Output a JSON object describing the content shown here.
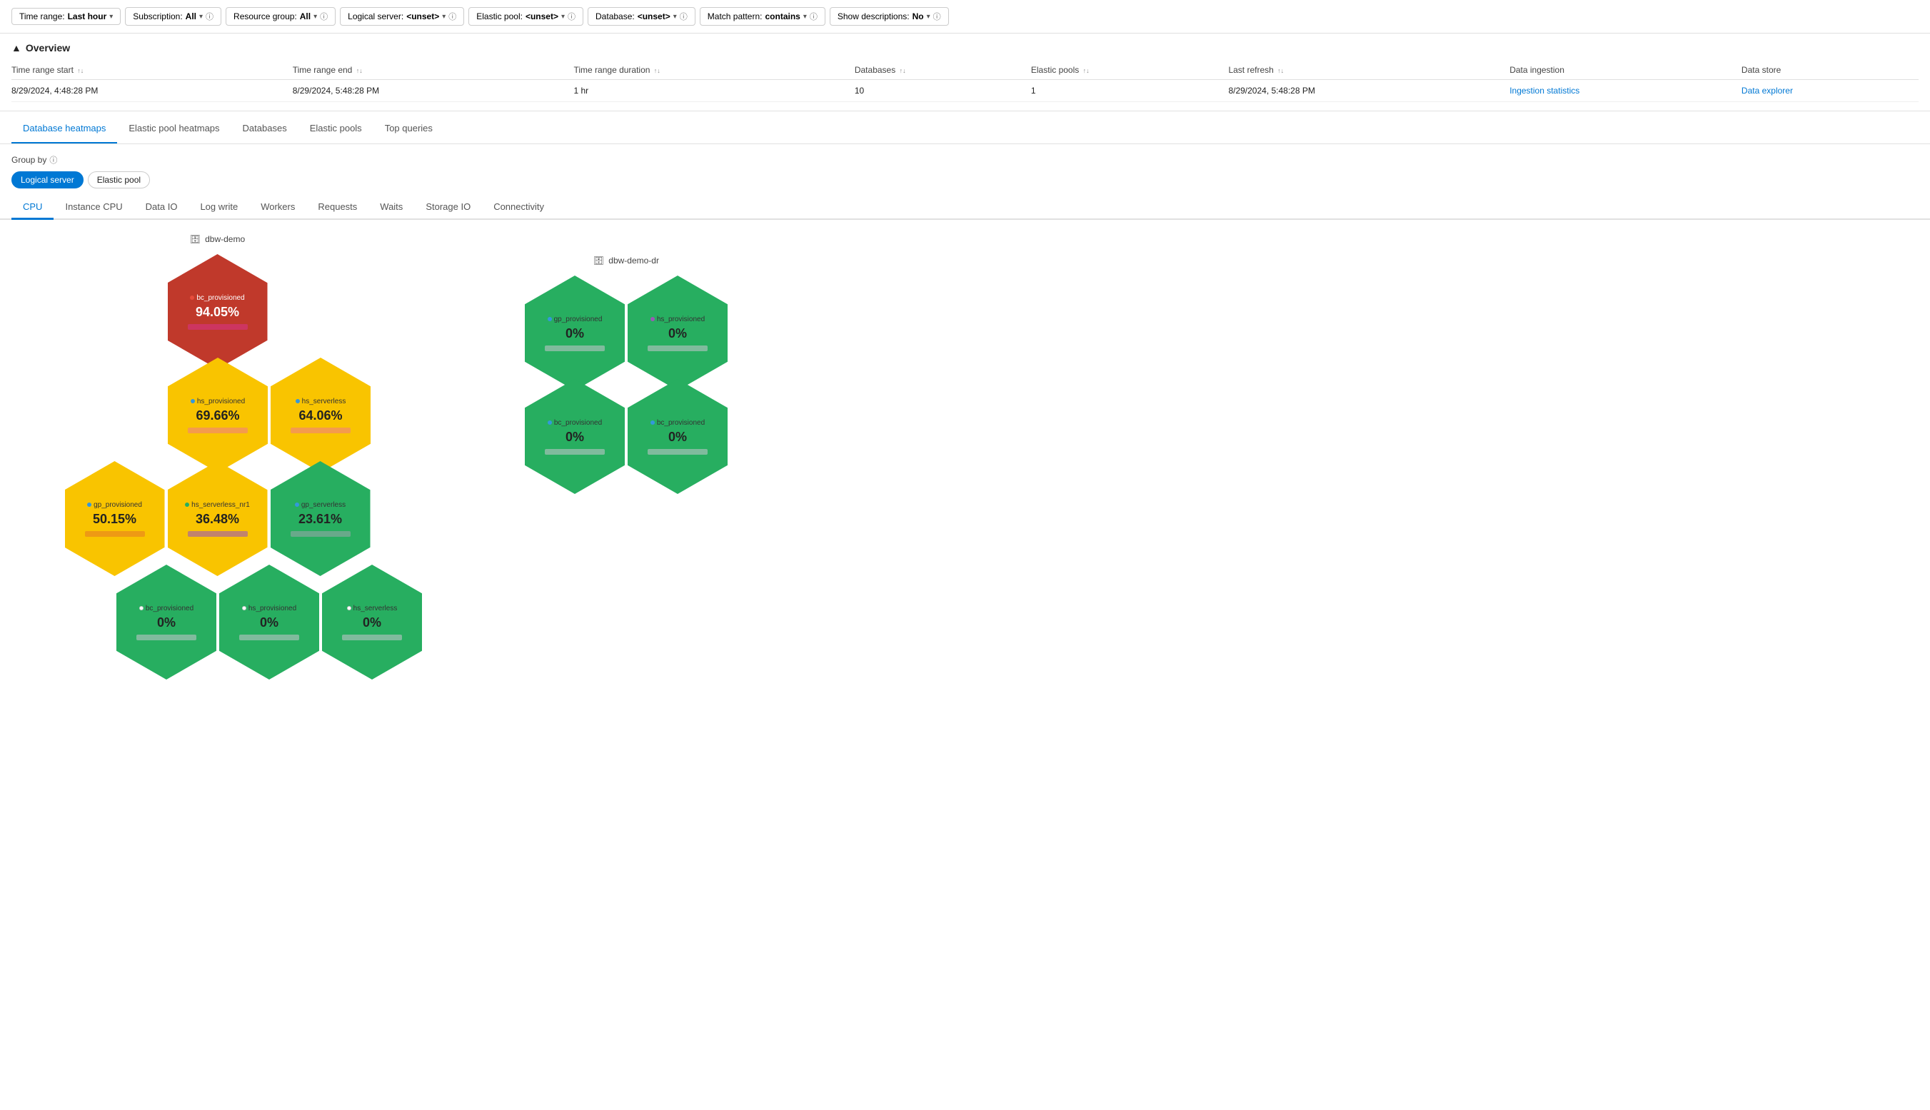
{
  "filterBar": {
    "timeRange": {
      "label": "Time range:",
      "value": "Last hour"
    },
    "subscription": {
      "label": "Subscription:",
      "value": "All"
    },
    "resourceGroup": {
      "label": "Resource group:",
      "value": "All"
    },
    "logicalServer": {
      "label": "Logical server:",
      "value": "<unset>"
    },
    "elasticPool": {
      "label": "Elastic pool:",
      "value": "<unset>"
    },
    "database": {
      "label": "Database:",
      "value": "<unset>"
    },
    "matchPattern": {
      "label": "Match pattern:",
      "value": "contains"
    },
    "showDescriptions": {
      "label": "Show descriptions:",
      "value": "No"
    }
  },
  "overview": {
    "title": "Overview",
    "table": {
      "columns": [
        {
          "id": "timeStart",
          "label": "Time range start",
          "sortable": true
        },
        {
          "id": "timeEnd",
          "label": "Time range end",
          "sortable": true
        },
        {
          "id": "duration",
          "label": "Time range duration",
          "sortable": true
        },
        {
          "id": "databases",
          "label": "Databases",
          "sortable": true
        },
        {
          "id": "elasticPools",
          "label": "Elastic pools",
          "sortable": true
        },
        {
          "id": "lastRefresh",
          "label": "Last refresh",
          "sortable": true
        },
        {
          "id": "dataIngestion",
          "label": "Data ingestion",
          "sortable": false
        },
        {
          "id": "dataStore",
          "label": "Data store",
          "sortable": false
        }
      ],
      "row": {
        "timeStart": "8/29/2024, 4:48:28 PM",
        "timeEnd": "8/29/2024, 5:48:28 PM",
        "duration": "1 hr",
        "databases": "10",
        "elasticPools": "1",
        "lastRefresh": "8/29/2024, 5:48:28 PM",
        "dataIngestion": "Ingestion statistics",
        "dataStore": "Data explorer"
      }
    }
  },
  "mainTabs": [
    {
      "id": "database-heatmaps",
      "label": "Database heatmaps",
      "active": true
    },
    {
      "id": "elastic-pool-heatmaps",
      "label": "Elastic pool heatmaps",
      "active": false
    },
    {
      "id": "databases",
      "label": "Databases",
      "active": false
    },
    {
      "id": "elastic-pools",
      "label": "Elastic pools",
      "active": false
    },
    {
      "id": "top-queries",
      "label": "Top queries",
      "active": false
    }
  ],
  "groupBy": {
    "label": "Group by",
    "options": [
      {
        "id": "logical-server",
        "label": "Logical server",
        "active": true
      },
      {
        "id": "elastic-pool",
        "label": "Elastic pool",
        "active": false
      }
    ]
  },
  "metricTabs": [
    {
      "id": "cpu",
      "label": "CPU",
      "active": true
    },
    {
      "id": "instance-cpu",
      "label": "Instance CPU",
      "active": false
    },
    {
      "id": "data-io",
      "label": "Data IO",
      "active": false
    },
    {
      "id": "log-write",
      "label": "Log write",
      "active": false
    },
    {
      "id": "workers",
      "label": "Workers",
      "active": false
    },
    {
      "id": "requests",
      "label": "Requests",
      "active": false
    },
    {
      "id": "waits",
      "label": "Waits",
      "active": false
    },
    {
      "id": "storage-io",
      "label": "Storage IO",
      "active": false
    },
    {
      "id": "connectivity",
      "label": "Connectivity",
      "active": false
    }
  ],
  "clusters": [
    {
      "id": "dbw-demo",
      "label": "dbw-demo",
      "rows": [
        [
          {
            "name": "bc_provisioned",
            "value": "94.05%",
            "color": "red",
            "dotColor": "red",
            "barColor": "bar-pink"
          }
        ],
        [
          {
            "name": "hs_provisioned",
            "value": "69.66%",
            "color": "yellow",
            "dotColor": "blue",
            "barColor": "bar-salmon"
          },
          {
            "name": "hs_serverless",
            "value": "64.06%",
            "color": "yellow",
            "dotColor": "blue",
            "barColor": "bar-salmon"
          }
        ],
        [
          {
            "name": "gp_provisioned",
            "value": "50.15%",
            "color": "yellow",
            "dotColor": "blue",
            "barColor": "bar-orange"
          },
          {
            "name": "hs_serverless_nr1",
            "value": "36.48%",
            "color": "yellow",
            "dotColor": "green",
            "barColor": "bar-purple"
          },
          {
            "name": "gp_serverless",
            "value": "23.61%",
            "color": "dark-green",
            "dotColor": "blue",
            "barColor": "bar-gray"
          }
        ],
        [
          {
            "name": "bc_provisioned",
            "value": "0%",
            "color": "dark-green",
            "dotColor": "white",
            "barColor": "bar-light-gray"
          },
          {
            "name": "hs_provisioned",
            "value": "0%",
            "color": "dark-green",
            "dotColor": "white",
            "barColor": "bar-light-gray"
          },
          {
            "name": "hs_serverless",
            "value": "0%",
            "color": "dark-green",
            "dotColor": "white",
            "barColor": "bar-light-gray"
          }
        ]
      ]
    },
    {
      "id": "dbw-demo-dr",
      "label": "dbw-demo-dr",
      "rows": [
        [
          {
            "name": "gp_provisioned",
            "value": "0%",
            "color": "dark-green",
            "dotColor": "blue",
            "barColor": "bar-light-gray"
          },
          {
            "name": "hs_provisioned",
            "value": "0%",
            "color": "dark-green",
            "dotColor": "purple",
            "barColor": "bar-light-gray"
          }
        ],
        [
          {
            "name": "bc_provisioned",
            "value": "0%",
            "color": "dark-green",
            "dotColor": "blue",
            "barColor": "bar-light-gray"
          },
          {
            "name": "bc_provisioned",
            "value": "0%",
            "color": "dark-green",
            "dotColor": "blue",
            "barColor": "bar-light-gray"
          }
        ]
      ]
    }
  ]
}
